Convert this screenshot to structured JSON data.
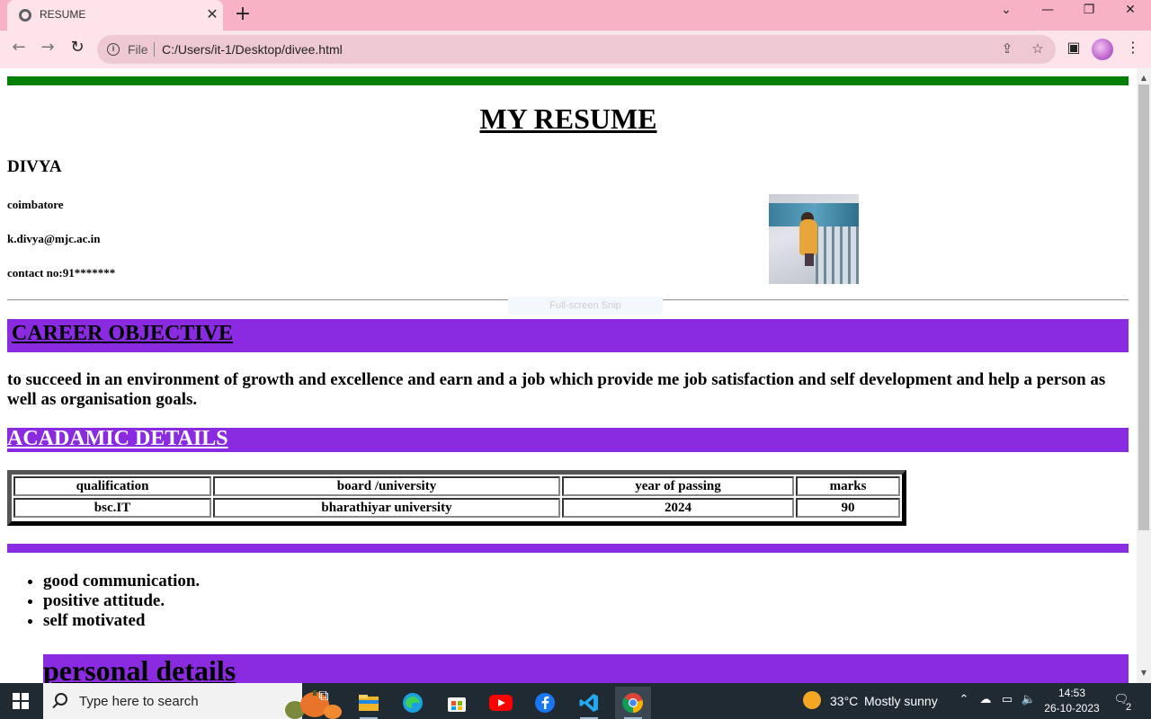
{
  "browser": {
    "tab_title": "RESUME",
    "tab_close": "✕",
    "new_tab": "+",
    "omnibox_scheme": "File",
    "omnibox_url": "C:/Users/it-1/Desktop/divee.html"
  },
  "page": {
    "title": "MY RESUME",
    "name": "DIVYA",
    "city": "coimbatore",
    "email": "k.divya@mjc.ac.in",
    "contact": "contact no:91*******",
    "snip_hint": "Full-screen Snip",
    "career_heading": "CAREER OBJECTIVE",
    "career_text": "to succeed in an environment of growth and excellence and earn and a job which provide me job satisfaction and self development and help a person as well as organisation goals.",
    "academic_heading": "ACADAMIC DETAILS",
    "table": {
      "headers": [
        "qualification",
        "board /university",
        "year of passing",
        "marks"
      ],
      "row": [
        "bsc.IT",
        "bharathiyar university",
        "2024",
        "90"
      ]
    },
    "skills": [
      "good communication.",
      "positive attitude.",
      "self motivated"
    ],
    "personal_heading": "personal details"
  },
  "taskbar": {
    "search_placeholder": "Type here to search",
    "weather_temp": "33°C",
    "weather_text": "Mostly sunny",
    "time": "14:53",
    "date": "26-10-2023",
    "notification_count": "2"
  },
  "colors": {
    "tabbar": "#f8b2c6",
    "green_rule": "#008000",
    "section_band": "#8a2be2",
    "taskbar": "#1f2a33"
  },
  "icons": [
    "globe-icon",
    "close-icon",
    "plus-icon",
    "chevron-down-icon",
    "minimize-icon",
    "restore-icon",
    "back-icon",
    "forward-icon",
    "reload-icon",
    "info-icon",
    "share-icon",
    "star-icon",
    "sidepanel-icon",
    "menu-icon",
    "windows-start-icon",
    "search-icon",
    "task-view-icon",
    "file-explorer-icon",
    "edge-icon",
    "store-icon",
    "youtube-icon",
    "facebook-icon",
    "vscode-icon",
    "chrome-icon",
    "weather-icon",
    "chevron-up-icon",
    "cloud-icon",
    "network-icon",
    "volume-icon",
    "notification-icon"
  ]
}
